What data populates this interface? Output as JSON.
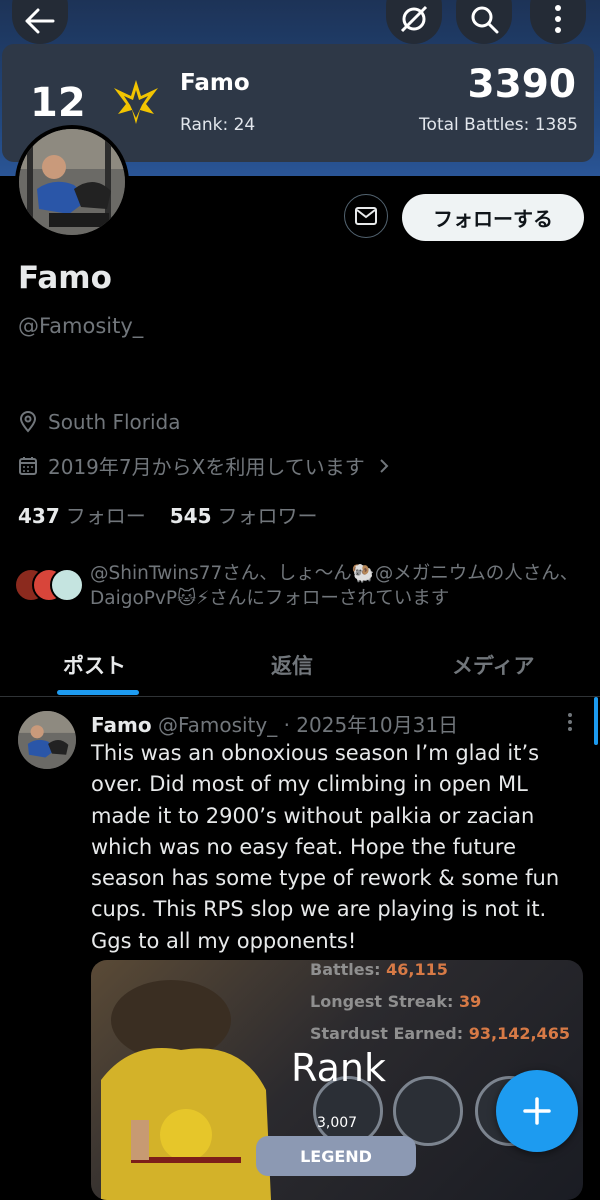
{
  "banner": {
    "level": "12",
    "name": "Famo",
    "rank": "Rank: 24",
    "rating": "3390",
    "total_battles": "Total Battles: 1385",
    "team_color": "#f2c400"
  },
  "actions": {
    "follow_label": "フォローする"
  },
  "profile": {
    "display_name": "Famo",
    "handle": "@Famosity_",
    "location": "South Florida",
    "joined": "2019年7月からXを利用しています",
    "following_count": "437",
    "following_label": "フォロー",
    "followers_count": "545",
    "followers_label": "フォロワー",
    "followed_by": "@ShinTwins77さん、しょ〜ん🐏@メガニウムの人さん、DaigoPvP🐱⚡さんにフォローされています"
  },
  "tabs": [
    {
      "label": "ポスト",
      "active": true
    },
    {
      "label": "返信",
      "active": false
    },
    {
      "label": "メディア",
      "active": false
    }
  ],
  "post": {
    "author": "Famo",
    "handle": "@Famosity_",
    "date": "· 2025年10月31日",
    "text": "This was an obnoxious season I’m glad it’s over. Did most of my climbing in open ML made it to 2900’s without palkia or zacian which was no easy feat. Hope the future season has some type of rework & some fun cups. This RPS slop we are playing is not it. Ggs to all my opponents!",
    "media": {
      "battles_label": "Battles:",
      "battles_value": "46,115",
      "streak_label": "Longest Streak:",
      "streak_value": "39",
      "stardust_label": "Stardust Earned:",
      "stardust_value": "93,142,465",
      "rank_title": "Rank",
      "rank_score": "3,007",
      "tier": "LEGEND"
    }
  },
  "icons": {
    "back": "arrow-left-icon",
    "hide": "eye-slash-icon",
    "search": "search-icon",
    "more": "more-vertical-icon",
    "message": "envelope-icon",
    "location": "map-pin-icon",
    "calendar": "calendar-icon",
    "compose": "plus-icon"
  },
  "colors": {
    "accent": "#1d9bf0",
    "background": "#000000",
    "muted": "#71767b"
  }
}
